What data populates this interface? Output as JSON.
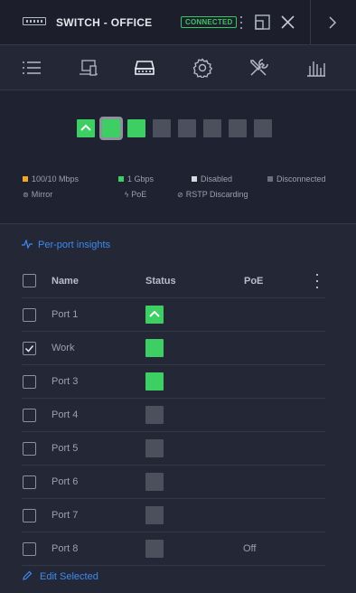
{
  "header": {
    "title": "SWITCH - OFFICE",
    "status_badge": "CONNECTED",
    "device_icon": "switch-device-icon",
    "kebab_icon": "kebab-menu-icon",
    "popout_icon": "popout-icon",
    "close_icon": "close-icon",
    "next_icon": "chevron-right-icon"
  },
  "tabs": [
    {
      "icon": "list-icon",
      "active": false
    },
    {
      "icon": "devices-icon",
      "active": false
    },
    {
      "icon": "ports-icon",
      "active": true
    },
    {
      "icon": "gear-icon",
      "active": false
    },
    {
      "icon": "tools-icon",
      "active": false
    },
    {
      "icon": "stats-icon",
      "active": false
    }
  ],
  "port_map": [
    {
      "state": "1g-uplink"
    },
    {
      "state": "1g-selected"
    },
    {
      "state": "1g"
    },
    {
      "state": "disconnected"
    },
    {
      "state": "disconnected"
    },
    {
      "state": "disconnected"
    },
    {
      "state": "disconnected"
    },
    {
      "state": "disconnected"
    }
  ],
  "legend": {
    "speed_100": "100/10 Mbps",
    "speed_1g": "1 Gbps",
    "disabled": "Disabled",
    "disconnected": "Disconnected",
    "mirror": "Mirror",
    "poe": "PoE",
    "rstp": "RSTP Discarding"
  },
  "colors": {
    "speed_100": "#f5a623",
    "speed_1g": "#3dcf63",
    "disabled": "#d6d9df",
    "disconnected": "#4c505c",
    "accent": "#3d8af0"
  },
  "insights_link": "Per-port insights",
  "table": {
    "headers": {
      "name": "Name",
      "status": "Status",
      "poe": "PoE"
    },
    "rows": [
      {
        "name": "Port 1",
        "checked": false,
        "status": "uplink",
        "poe": ""
      },
      {
        "name": "Work",
        "checked": true,
        "status": "up",
        "poe": ""
      },
      {
        "name": "Port 3",
        "checked": false,
        "status": "up",
        "poe": ""
      },
      {
        "name": "Port 4",
        "checked": false,
        "status": "down",
        "poe": ""
      },
      {
        "name": "Port 5",
        "checked": false,
        "status": "down",
        "poe": ""
      },
      {
        "name": "Port 6",
        "checked": false,
        "status": "down",
        "poe": ""
      },
      {
        "name": "Port 7",
        "checked": false,
        "status": "down",
        "poe": ""
      },
      {
        "name": "Port 8",
        "checked": false,
        "status": "down",
        "poe": "Off"
      }
    ]
  },
  "edit_link": "Edit Selected"
}
